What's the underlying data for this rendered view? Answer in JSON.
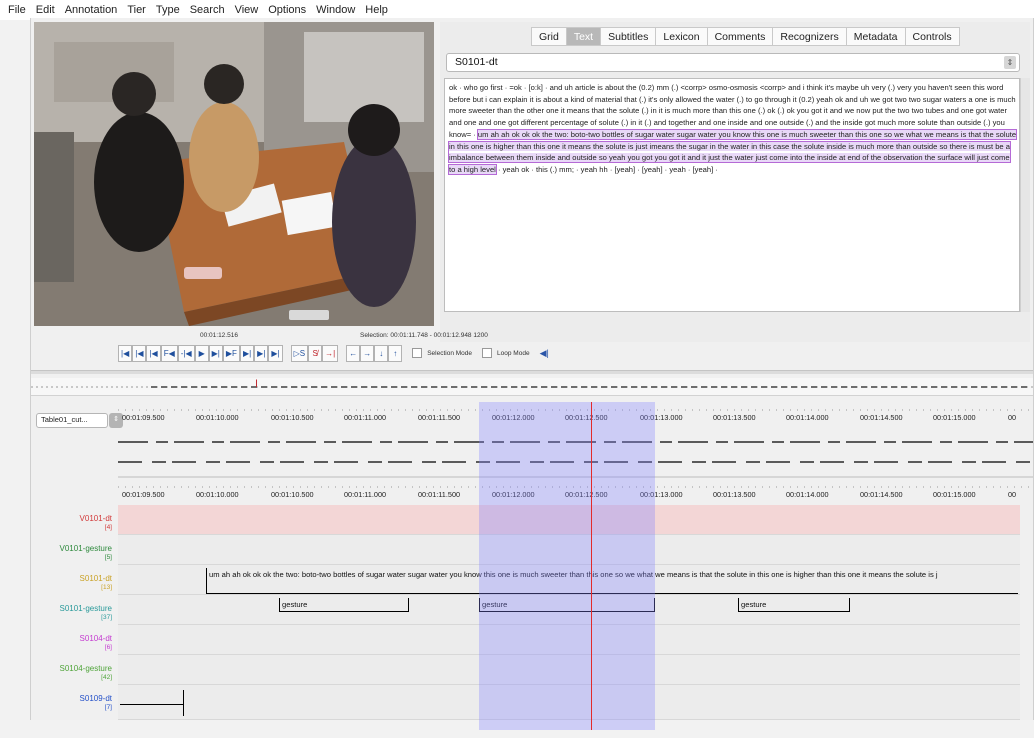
{
  "menu": [
    "File",
    "Edit",
    "Annotation",
    "Tier",
    "Type",
    "Search",
    "View",
    "Options",
    "Window",
    "Help"
  ],
  "tabs": [
    {
      "label": "Grid",
      "active": false
    },
    {
      "label": "Text",
      "active": true
    },
    {
      "label": "Subtitles",
      "active": false
    },
    {
      "label": "Lexicon",
      "active": false
    },
    {
      "label": "Comments",
      "active": false
    },
    {
      "label": "Recognizers",
      "active": false
    },
    {
      "label": "Metadata",
      "active": false
    },
    {
      "label": "Controls",
      "active": false
    }
  ],
  "tier_select": "S0101-dt",
  "text_view": {
    "before": "ok · who go first · =ok · [o:k] · and uh article is about the (0.2) mm (.) <corrp> osmo-osmosis <corrp> and i think it's maybe uh very (.) very you haven't seen this word before but i can explain it is about a kind of material that (.) it's only allowed the water (.) to go through it (0.2) yeah ok and uh we got two two sugar waters a one is much more sweeter than the other one it means that the solute (.) in it is much more than this one (.) ok (.) ok you got it and we now put the two two tubes and one got water and one and one got different percentage of solute (.) in it (.) and together and one inside and one outside (.) and the inside got much more solute than outside (.) you know= · ",
    "highlight": "um ah ah ok ok ok the two: boto-two bottles of sugar water sugar water you know this one is much sweeter than this one so we what we means is that the solute in this one is higher than this one it means the solute is just imeans the sugar in the water in this case the solute inside is much more than outside so there is must be a imbalance between them inside and outside so yeah you got you got it and it just the water just come into the inside at end of the observation the surface will just come to a high level",
    "after": " · yeah ok · this (.) mm; · yeah hh · [yeah] · [yeah] · yeah · [yeah] ·"
  },
  "media_time": "00:01:12.516",
  "selection_info": "Selection: 00:01:11.748 - 00:01:12.948  1200",
  "controls": [
    "|◀",
    "|◀",
    "|◀",
    "F◀",
    "-|◀",
    "▶",
    "▶|",
    "▶F",
    "▶|",
    "▶|",
    "▶|"
  ],
  "sel_controls": [
    "▷S",
    "S̸",
    "→|"
  ],
  "nav_controls": [
    "←",
    "→",
    "↓",
    "↑"
  ],
  "selection_mode_label": "Selection Mode",
  "loop_mode_label": "Loop Mode",
  "timeline_select": "Table01_cut...",
  "ticks": [
    "00:01:09.500",
    "00:01:10.000",
    "00:01:10.500",
    "00:01:11.000",
    "00:01:11.500",
    "00:01:12.000",
    "00:01:12.500",
    "00:01:13.000",
    "00:01:13.500",
    "00:01:14.000",
    "00:01:14.500",
    "00:01:15.000",
    "00"
  ],
  "tiers": [
    {
      "name": "V0101-dt",
      "count": "[4]",
      "color": "#d23a3a"
    },
    {
      "name": "V0101-gesture",
      "count": "[5]",
      "color": "#2f8a3e"
    },
    {
      "name": "S0101-dt",
      "count": "[13]",
      "color": "#c9a227"
    },
    {
      "name": "S0101-gesture",
      "count": "[37]",
      "color": "#2a9a9a"
    },
    {
      "name": "S0104-dt",
      "count": "[6]",
      "color": "#c43bd0"
    },
    {
      "name": "S0104-gesture",
      "count": "[42]",
      "color": "#4fa43a"
    },
    {
      "name": "S0109-dt",
      "count": "[7]",
      "color": "#2450c8"
    }
  ],
  "annotation_long": "um ah ah ok ok ok the two: boto-two bottles of sugar water sugar water you know this one is much sweeter than this one so we what we means is that the solute in this one is higher than this one it means the solute is j",
  "gesture_label": "gesture"
}
